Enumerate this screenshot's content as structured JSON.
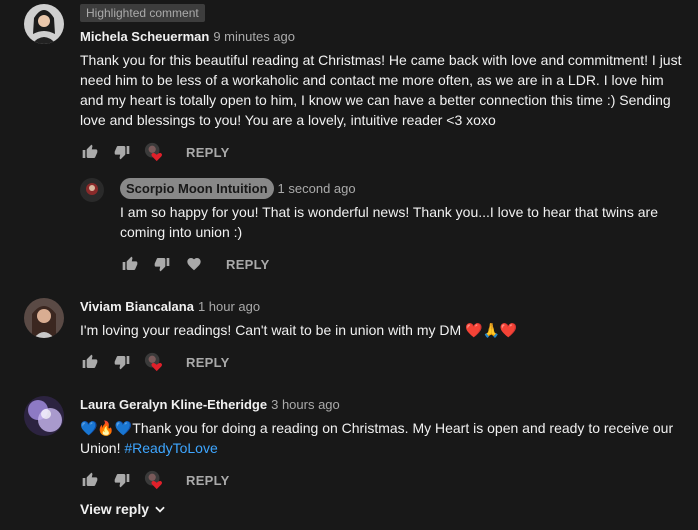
{
  "comments": [
    {
      "badge": "Highlighted comment",
      "author": "Michela Scheuerman",
      "time": "9 minutes ago",
      "text": "Thank you for this beautiful reading at Christmas! He came back with love and commitment! I just\nneed him to be less of a workaholic and contact me more often, as we are in a LDR. I love him\nand my heart is totally open to him, I know we can have a better connection this time :) Sending\nlove and blessings to you! You are a lovely, intuitive reader <3 xoxo",
      "reply_label": "REPLY"
    },
    {
      "author": "Scorpio Moon Intuition",
      "time": "1 second ago",
      "text": "I am so happy for you! That is wonderful news! Thank you...I love to hear that twins are\ncoming into union :)",
      "reply_label": "REPLY"
    },
    {
      "author": "Viviam Biancalana",
      "time": "1 hour ago",
      "text": "I'm loving your readings! Can't wait to be in union with my DM ❤️🙏❤️",
      "reply_label": "REPLY"
    },
    {
      "author": "Laura Geralyn Kline-Etheridge",
      "time": "3 hours ago",
      "text_prefix": "💙🔥💙Thank you for doing a reading on Christmas. My Heart is open and ready to receive our\nUnion! ",
      "hashtag": "#ReadyToLove",
      "reply_label": "REPLY"
    }
  ],
  "view_reply": "View reply",
  "colors": {
    "background": "#181818",
    "link": "#3ea6ff",
    "heart": "#e0202a"
  }
}
